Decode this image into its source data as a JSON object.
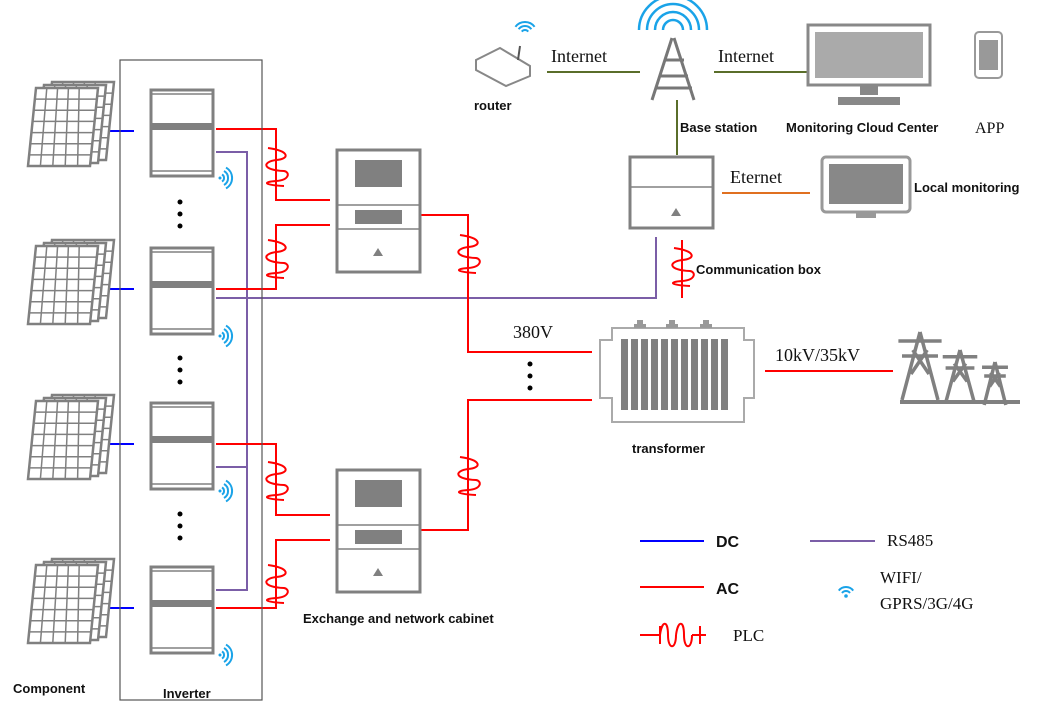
{
  "labels": {
    "router": "router",
    "internet_left": "Internet",
    "internet_right": "Internet",
    "base_station": "Base station",
    "monitoring_cloud_center": "Monitoring Cloud Center",
    "app": "APP",
    "eternet": "Eternet",
    "local_monitoring": "Local monitoring",
    "communication_box": "Communication box",
    "voltage_low": "380V",
    "voltage_high": "10kV/35kV",
    "transformer": "transformer",
    "cabinet": "Exchange and network cabinet",
    "component": "Component",
    "inverter": "Inverter"
  },
  "legend": {
    "dc": "DC",
    "ac": "AC",
    "plc": "PLC",
    "rs485": "RS485",
    "wifi_line1": "WIFI/",
    "wifi_line2": "GPRS/3G/4G"
  },
  "colors": {
    "dc": "#0000ff",
    "ac": "#ff0000",
    "rs485": "#7b5ea7",
    "internet": "#5a6e2a",
    "ethernet": "#e07020",
    "wifi": "#1aa3e8",
    "device": "#808080"
  }
}
